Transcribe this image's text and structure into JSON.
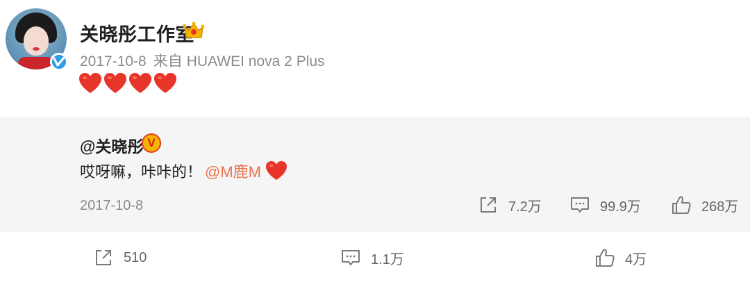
{
  "post": {
    "author": "关晓彤工作室",
    "date": "2017-10-8",
    "source_prefix": "来自",
    "source_device": "HUAWEI nova 2 Plus",
    "heart_count": 4
  },
  "quoted": {
    "author": "@关晓彤",
    "badge": "V",
    "text": "哎呀嘛，咔咔的！",
    "mention": "@M鹿M",
    "date": "2017-10-8",
    "repost_count": "7.2万",
    "comment_count": "99.9万",
    "like_count": "268万"
  },
  "actions": {
    "repost_count": "510",
    "comment_count": "1.1万",
    "like_count": "4万"
  },
  "colors": {
    "mention": "#eb7350",
    "verified_blue": "#2d9de4",
    "heart_red": "#e8352a",
    "quote_bg": "#f5f5f5"
  },
  "icons": [
    "crown-icon",
    "verified-icon",
    "heart-icon",
    "repost-icon",
    "comment-icon",
    "like-icon"
  ]
}
